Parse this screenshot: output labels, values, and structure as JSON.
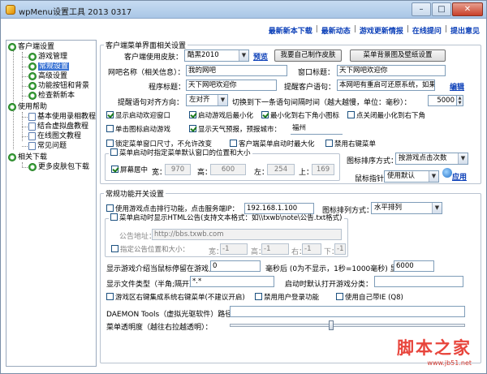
{
  "window": {
    "title": "wpMenu设置工具 2013 0317",
    "min": "–",
    "max": "□",
    "close": "✕"
  },
  "toplinks": [
    "最新新本下载",
    "最新动态",
    "游戏更新情报",
    "在线提问",
    "提出意见"
  ],
  "sidebar": {
    "groups": [
      {
        "label": "客户端设置",
        "items": [
          "游戏管理",
          "常规设置",
          "高级设置",
          "功能按钮和背景",
          "检查新新本"
        ]
      },
      {
        "label": "使用帮助",
        "items": [
          "基本使用录相教程",
          "结合虚拟盘教程",
          "在线图文教程",
          "常见问题"
        ]
      },
      {
        "label": "相关下载",
        "items": [
          "更多皮肤包下载"
        ]
      }
    ],
    "selected": "常规设置"
  },
  "sec1": {
    "legend": "客户端菜单界面相关设置",
    "skin_label": "客户端使用皮肤：",
    "skin_value": "酷黑2010",
    "preview_link": "预览",
    "make_skin_btn": "我要自己制作皮肤",
    "bg_btn": "菜单背景图及壁纸设置",
    "netbar_label": "网吧名称（相关信息）：",
    "netbar_value": "我的网吧",
    "window_title_label": "窗口标题：",
    "window_title_value": "天下网吧欢迎你",
    "prog_title_label": "程序标题：",
    "prog_title_value": "天下网吧欢迎你",
    "tip_label": "提醒客户语句：",
    "tip_value": "本网吧有重启可还原系统，如果M",
    "edit_link": "编辑",
    "scroll_label": "提醒语句对齐方向：",
    "scroll_value": "左对齐",
    "switch_label": "切换到下一条语句间隔时间（越大越慢，单位：毫秒）：",
    "switch_value": "5000",
    "checks_row1": [
      "显示启动欢迎窗口",
      "启动游戏后最小化",
      "最小化到右下角小图标",
      "点关闭最小化到右下角"
    ],
    "checks_row1_on": [
      true,
      true,
      true,
      false
    ],
    "checks_row2": [
      "单击图标启动游戏",
      "显示天气预报，预报城市："
    ],
    "checks_row2_on": [
      false,
      true
    ],
    "city_value": "福州",
    "checks_row3": [
      "锁定菜单窗口尺寸，不允许改变",
      "客户端菜单启动时最大化",
      "禁用右键菜单"
    ],
    "checks_row3_on": [
      false,
      false,
      false
    ],
    "pos_check": "菜单启动时指定菜单默认窗口的位置和大小",
    "pos_check_on": false,
    "center_check": "屏幕居中",
    "center_check_on": true,
    "w_label": "宽：",
    "w_value": "970",
    "h_label": "高：",
    "h_value": "600",
    "l_label": "左：",
    "l_value": "254",
    "t_label": "上：",
    "t_value": "169",
    "sort_label": "图标排序方式：",
    "sort_value": "按游戏点击次数",
    "pointer_label": "鼠标指针：",
    "pointer_value": "使用默认",
    "apply_link": "应用"
  },
  "sec2": {
    "legend": "常规功能开关设置",
    "count_check": "使用游戏点击排行功能，点击服务端IP：",
    "count_ip": "192.168.1.100",
    "arrange_label": "图标排列方式：",
    "arrange_value": "水平排列",
    "notice_check": "菜单启动时显示HTML公告(支持文本格式：如\\\\txwb\\note\\公告.txt格式)",
    "notice_addr_label": "公告地址：",
    "notice_addr_value": "http://bbs.txwb.com",
    "notice_pos_check": "指定公告位置和大小：",
    "np_w_label": "宽：",
    "np_w": "-1",
    "np_h_label": "高：",
    "np_h": "-1",
    "np_l_label": "右：",
    "np_l": "-1",
    "np_t_label": "下：",
    "np_t": "-1",
    "hover_label": "显示游戏介绍当鼠标停留在游戏上",
    "hover_value": "0",
    "hover_unit": "毫秒后 (0为不显示，1秒=1000毫秒) 显示时间：",
    "hover_time": "6000",
    "files_label": "显示文件类型（半角;隔开）",
    "files_value": "*.*",
    "default_open_label": "启动时默认打开游戏分类：",
    "default_open_value": "",
    "checks_row4": [
      "游戏区右键集成系统右键菜单(不建议开启)",
      "禁用用户登录功能",
      "使用自己带IE (Q8)"
    ],
    "checks_row4_on": [
      false,
      false,
      false
    ],
    "daemon_label": "DAEMON Tools（虚拟光驱软件）路径：",
    "daemon_value": "",
    "opacity_label": "菜单透明度（越往右拉越透明）：",
    "opacity": 0
  },
  "watermark": {
    "big": "脚本之家",
    "small": "www.jb51.net"
  }
}
